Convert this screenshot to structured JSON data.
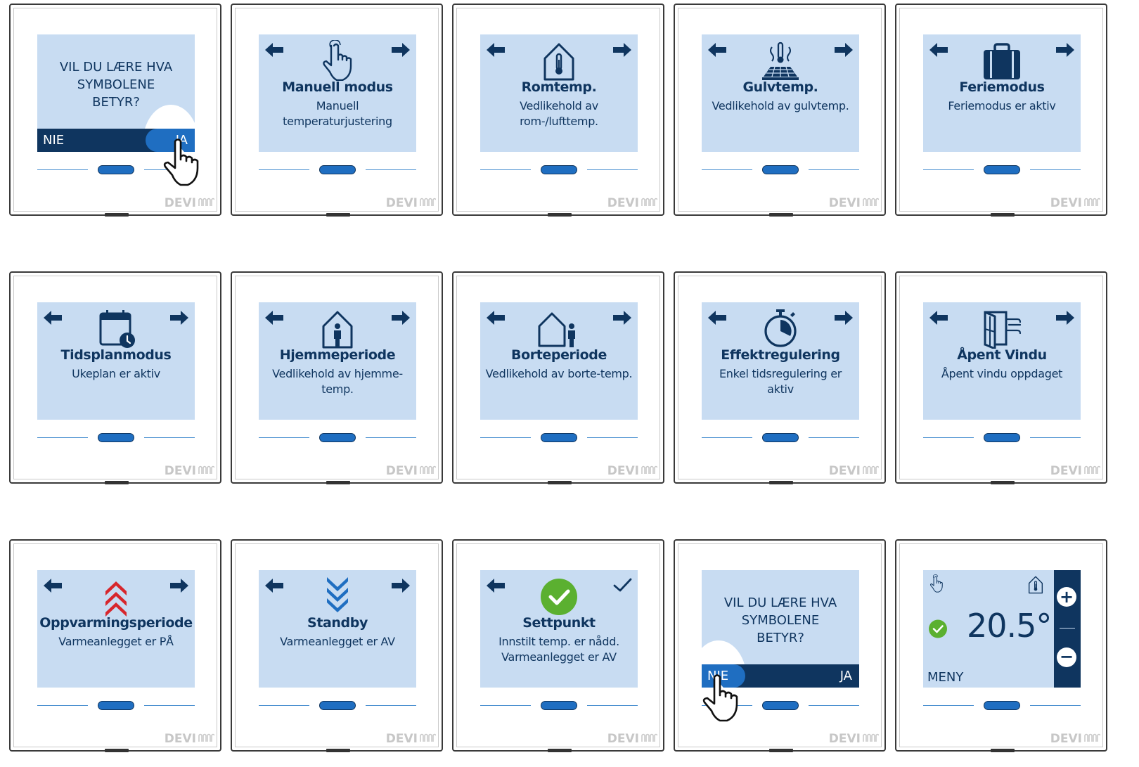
{
  "brand": "DEVI",
  "colors": {
    "screen_bg": "#c8dcf2",
    "dark_blue": "#0f355f",
    "accent_blue": "#1f6ec1",
    "heat_red": "#d7262c",
    "ok_green": "#5bb030"
  },
  "cards": [
    {
      "type": "question",
      "question": "VIL DU LÆRE HVA SYMBOLENE BETYR?",
      "no": "NIE",
      "yes": "JA",
      "touch": "yes"
    },
    {
      "type": "mode",
      "icon": "hand-icon",
      "title": "Manuell modus",
      "subtitle": "Manuell temperaturjustering",
      "arrow_right": "arrow"
    },
    {
      "type": "mode",
      "icon": "room-thermometer-icon",
      "title": "Romtemp.",
      "subtitle": "Vedlikehold av rom-/lufttemp.",
      "arrow_right": "arrow"
    },
    {
      "type": "mode",
      "icon": "floor-heating-icon",
      "title": "Gulvtemp.",
      "subtitle": "Vedlikehold av gulvtemp.",
      "arrow_right": "arrow"
    },
    {
      "type": "mode",
      "icon": "suitcase-icon",
      "title": "Feriemodus",
      "subtitle": "Feriemodus er aktiv",
      "arrow_right": "arrow"
    },
    {
      "type": "mode",
      "icon": "calendar-clock-icon",
      "title": "Tidsplanmodus",
      "subtitle": "Ukeplan er aktiv",
      "arrow_right": "arrow"
    },
    {
      "type": "mode",
      "icon": "home-person-icon",
      "title": "Hjemmeperiode",
      "subtitle": "Vedlikehold av hjemme-temp.",
      "arrow_right": "arrow"
    },
    {
      "type": "mode",
      "icon": "away-house-icon",
      "title": "Borteperiode",
      "subtitle": "Vedlikehold av borte-temp.",
      "arrow_right": "arrow"
    },
    {
      "type": "mode",
      "icon": "stopwatch-icon",
      "title": "Effektregulering",
      "subtitle": "Enkel tidsregulering er aktiv",
      "arrow_right": "arrow"
    },
    {
      "type": "mode",
      "icon": "open-window-icon",
      "title": "Åpent Vindu",
      "subtitle": "Åpent vindu oppdaget",
      "arrow_right": "arrow"
    },
    {
      "type": "mode",
      "icon": "heating-chevrons-icon",
      "title": "Oppvarmingsperiode",
      "subtitle": "Varmeanlegget er PÅ",
      "arrow_right": "arrow"
    },
    {
      "type": "mode",
      "icon": "standby-chevrons-icon",
      "title": "Standby",
      "subtitle": "Varmeanlegget er AV",
      "arrow_right": "arrow"
    },
    {
      "type": "mode",
      "icon": "green-check-icon",
      "title": "Settpunkt",
      "subtitle": "Innstilt temp. er nådd. Varmeanlegget er AV",
      "arrow_right": "check"
    },
    {
      "type": "question",
      "question": "VIL DU LÆRE HVA SYMBOLENE BETYR?",
      "no": "NIE",
      "yes": "JA",
      "touch": "no"
    },
    {
      "type": "home",
      "temperature": "20.5°",
      "menu": "MENY",
      "plus": "+",
      "minus": "−"
    }
  ]
}
